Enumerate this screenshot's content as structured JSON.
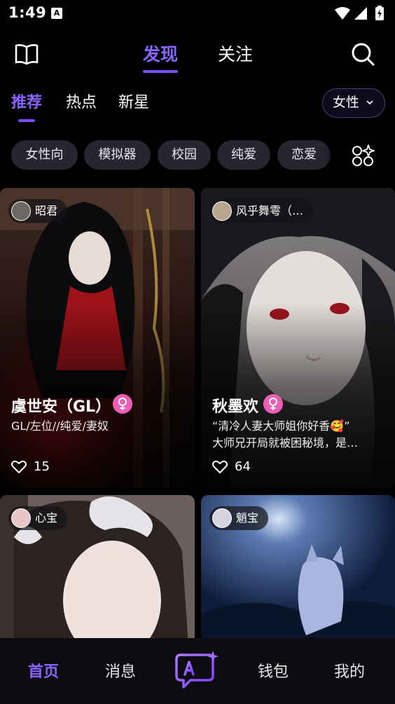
{
  "status": {
    "time": "1:49",
    "notification_badge": "A"
  },
  "topnav": {
    "tabs": [
      "发现",
      "关注"
    ],
    "active_tab": "发现"
  },
  "subnav": {
    "tabs": [
      "推荐",
      "热点",
      "新星"
    ],
    "active_tab": "推荐",
    "gender_filter": "女性"
  },
  "chips": [
    "女性向",
    "模拟器",
    "校园",
    "纯爱",
    "恋爱"
  ],
  "cards": [
    {
      "author": "昭君",
      "title": "虞世安（GL）",
      "desc": [
        "GL/左位//纯爱/妻奴"
      ],
      "likes": "15"
    },
    {
      "author": "风乎舞雩（…",
      "title": "秋墨欢",
      "desc": [
        "“清冷人妻大师姐你好香🥰”",
        "大师兄开局就被困秘境，是…"
      ],
      "likes": "64"
    },
    {
      "author": "心宝"
    },
    {
      "author": "魈宝"
    }
  ],
  "bottom_nav": {
    "items": [
      "首页",
      "消息",
      "钱包",
      "我的"
    ],
    "active": "首页",
    "center_icon": "ai-chat-icon"
  },
  "colors": {
    "accent": "#8A63FF",
    "female_badge": "#EA5FB4",
    "chip_bg": "#262630",
    "background": "#000000"
  }
}
